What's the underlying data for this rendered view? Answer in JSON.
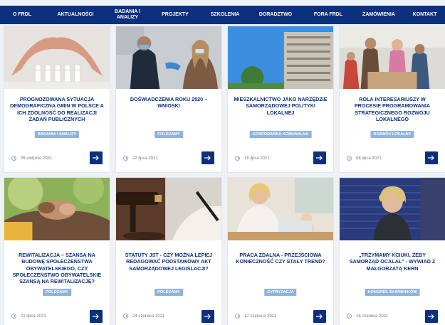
{
  "nav": {
    "items": [
      "O FRDL",
      "AKTUALNOŚCI",
      "BADANIA I ANALIZY",
      "PROJEKTY",
      "SZKOLENIA",
      "DORADZTWO",
      "FORA FRDL",
      "ZAMÓWIENIA",
      "KONTAKT"
    ]
  },
  "cards": [
    {
      "title": "PROGNOZOWANA SYTUACJA DEMOGRAFICZNA GMIN W POLSCE A ICH ZDOLNOŚĆ DO REALIZACJI ZADAŃ PUBLICZNYCH",
      "tag": "BADANIA I ANALIZY",
      "date": "05 sierpnia 2021",
      "image_icon": "paper-people-hands-image"
    },
    {
      "title": "DOŚWIADCZENIA ROKU 2020 – WNIOSKI",
      "tag": "POLECAMY",
      "date": "22 lipca 2021",
      "image_icon": "masked-people-image"
    },
    {
      "title": "MIESZKALNICTWO JAKO NARZĘDZIE SAMORZĄDOWEJ POLITYKI LOKALNEJ",
      "tag": "GOSPODARKA KOMUNALNA",
      "date": "15 lipca 2021",
      "image_icon": "apartment-building-image"
    },
    {
      "title": "ROLA INTERESARIUSZY W PROCESIE PROGRAMOWANIA STRATEGICZNEGO ROZWOJU LOKALNEGO",
      "tag": "ROZWÓJ LOKALNY",
      "date": "08 lipca 2021",
      "image_icon": "meeting-people-image"
    },
    {
      "title": "REWITALIZACJA – SZANSĄ NA BUDOWĘ SPOŁECZEŃSTWA OBYWATELSKIEGO, CZY SPOŁECZEŃSTWO OBYWATELSKIE SZANSĄ NA REWITALIZACJĘ?",
      "tag": "POLECAMY",
      "date": "01 lipca 2021",
      "image_icon": "joined-hands-image"
    },
    {
      "title": "STATUTY JST - CZY MOŻNA LEPIEJ REDAGOWAĆ PODSTAWOWY AKT SAMORZĄDOWEJ LEGISLACJI?",
      "tag": "POLECAMY",
      "date": "24 czerwca 2021",
      "image_icon": "gavel-pen-image"
    },
    {
      "title": "PRACA ZDALNA - PRZEJŚCIOWA KONIECZNOŚĆ CZY STAŁY TREND?",
      "tag": "CYFRYZACJA",
      "date": "17 czerwca 2021",
      "image_icon": "remote-work-image"
    },
    {
      "title": "„TRZYMAMY KCIUKI, ŻEBY SAMORZĄD OCALAŁ” - WYWIAD Z MAŁGORZATĄ KERN",
      "tag": "KONGRES SKARBNIKÓW",
      "date": "16 czerwca 2021",
      "image_icon": "woman-portrait-image"
    }
  ],
  "colors": {
    "nav": "#0c2f7e",
    "title": "#0c2f7e",
    "tag": "#8fb2dd",
    "button": "#0c2f7e"
  }
}
